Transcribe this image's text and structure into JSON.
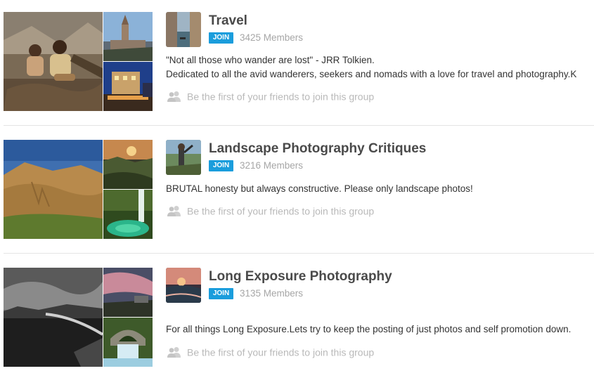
{
  "groups": [
    {
      "title": "Travel",
      "join_label": "JOIN",
      "members": "3425 Members",
      "description_lines": [
        "\"Not all those who wander are lost\" - JRR Tolkien.",
        "Dedicated to all the avid wanderers, seekers and nomads with a love for travel and photography.K"
      ],
      "friends_text": "Be the first of your friends to join this group",
      "photos": [
        "children-photo",
        "church-photo",
        "night-street-photo"
      ],
      "thumbnail": "venice-canal-photo"
    },
    {
      "title": "Landscape Photography Critiques",
      "join_label": "JOIN",
      "members": "3216 Members",
      "description_lines": [
        "BRUTAL honesty but always constructive. Please only landscape photos!"
      ],
      "friends_text": "Be the first of your friends to join this group",
      "photos": [
        "mountain-photo",
        "sunset-valley-photo",
        "waterfall-photo"
      ],
      "thumbnail": "photographer-photo"
    },
    {
      "title": "Long Exposure Photography",
      "join_label": "JOIN",
      "members": "3135 Members",
      "description_lines": [
        "For all things Long Exposure.Lets try to keep the posting of just photos and self promotion down."
      ],
      "friends_text": "Be the first of your friends to join this group",
      "photos": [
        "bw-lake-photo",
        "pink-sky-photo",
        "stone-bridge-waterfall-photo"
      ],
      "thumbnail": "sunset-beach-photo"
    }
  ],
  "colors": {
    "join_button": "#1a9ddc",
    "title": "#4a4a4a",
    "muted": "#a6a6a6"
  },
  "icons": {
    "friends": "people-icon"
  }
}
